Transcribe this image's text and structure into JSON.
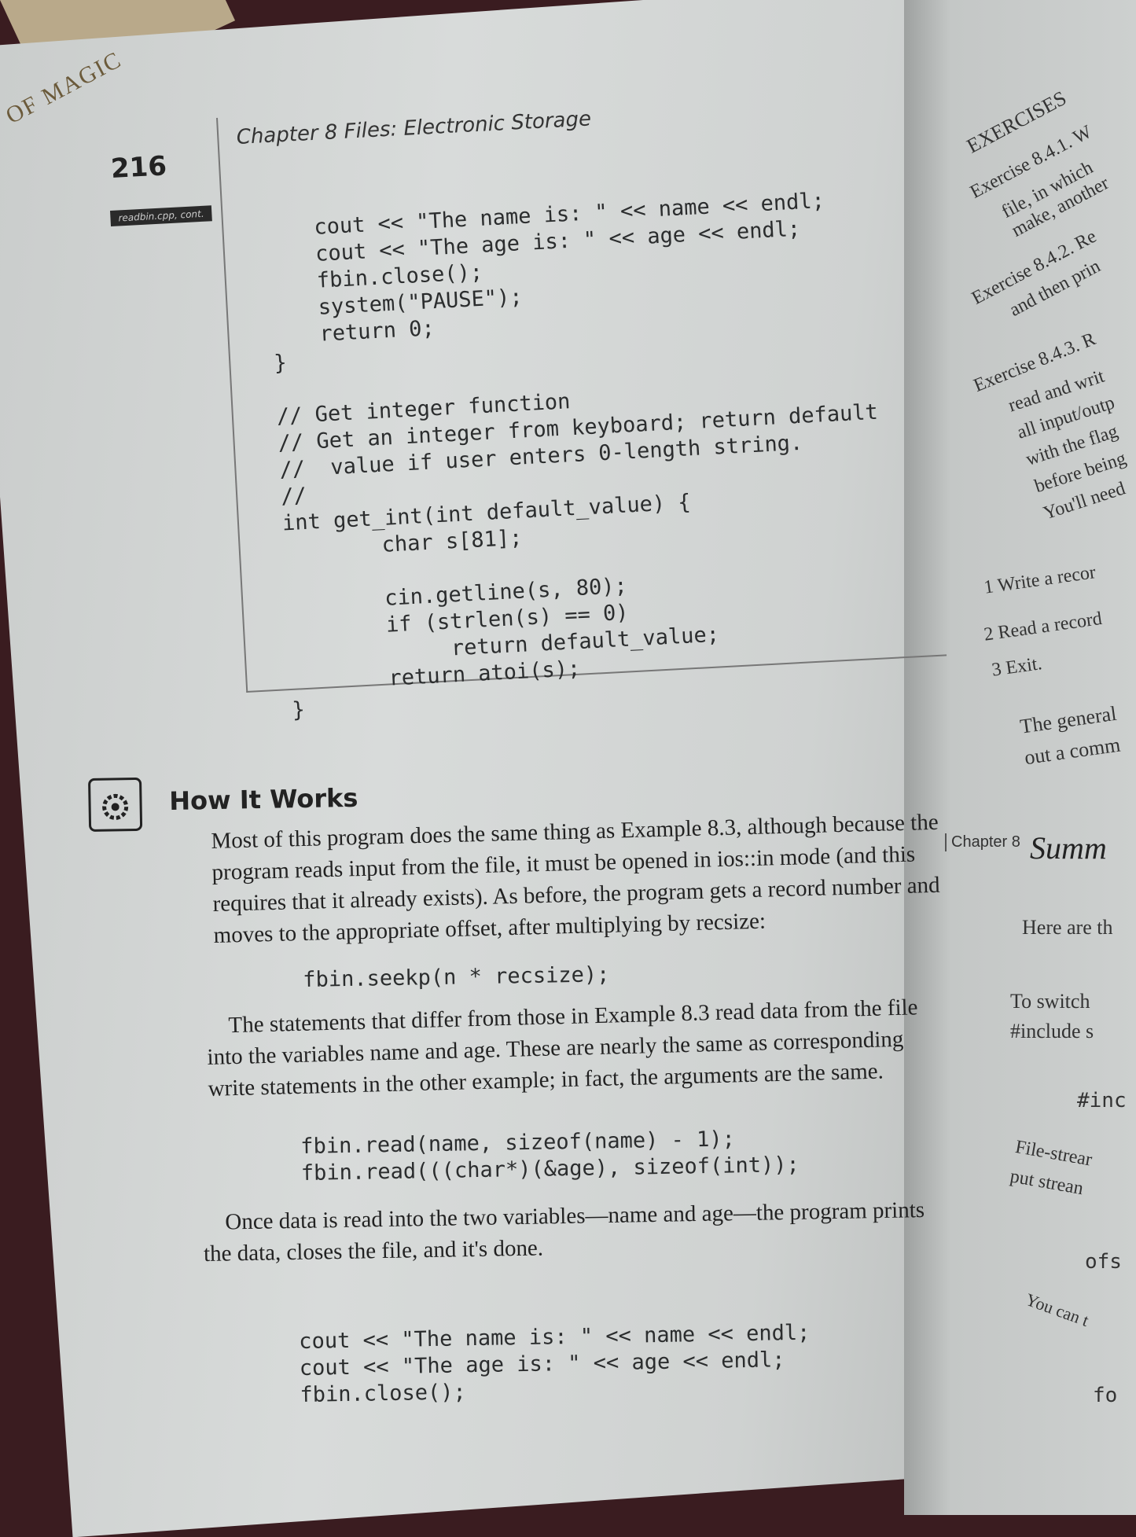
{
  "header": {
    "page_number": "216",
    "chapter": "Chapter 8   Files: Electronic Storage",
    "file_tag": "readbin.cpp, cont.",
    "edge_text": "OF MAGIC"
  },
  "code_listing": [
    "cout << \"The name is: \" << name << endl;",
    "cout << \"The age is: \" << age << endl;",
    "fbin.close();",
    "system(\"PAUSE\");",
    "return 0;",
    "}",
    "",
    "// Get integer function",
    "// Get an integer from keyboard; return default",
    "//  value if user enters 0-length string.",
    "//",
    "int get_int(int default_value) {",
    "    char s[81];",
    "",
    "    cin.getline(s, 80);",
    "    if (strlen(s) == 0)",
    "         return default_value;",
    "    return atoi(s);",
    "}"
  ],
  "how_it_works": {
    "icon_label": "How it Works",
    "title": "How It Works",
    "para1": "Most of this program does the same thing as Example 8.3, although because the program reads input from the file, it must be opened in ios::in mode (and this requires that it already exists). As before, the program gets a record number and moves to the appropriate offset, after multiplying by recsize:",
    "code1": "fbin.seekp(n * recsize);",
    "para2": "The statements that differ from those in Example 8.3 read data from the file into the variables name and age. These are nearly the same as corresponding write statements in the other example; in fact, the arguments are the same.",
    "code2": "fbin.read(name, sizeof(name) - 1);\nfbin.read(((char*)(&age), sizeof(int));",
    "para3": "Once data is read into the two variables—name and age—the program prints the data, closes the file, and it's done.",
    "code3": "cout << \"The name is: \" << name << endl;\ncout << \"The age is: \" << age << endl;\nfbin.close();"
  },
  "right_page": {
    "exercises_heading": "EXERCISES",
    "ex1": "Exercise 8.4.1.  W",
    "ex1_text": "file, in which \nmake, another",
    "ex2": "Exercise 8.4.2.  Re",
    "ex2_text": "and then prin",
    "ex3": "Exercise 8.4.3.  R",
    "ex3_text": "read and writ\nall input/outp\nwith the flag\nbefore being\nYou'll need",
    "menu": [
      "1  Write a recor",
      "2  Read a record",
      "3  Exit."
    ],
    "general": "The general\nout a comm",
    "chapter_label": "Chapter 8",
    "summary": "Summ",
    "here": "Here are th",
    "bullets": [
      "To switch\n#include s",
      "#inc",
      "File-strear\nput strean",
      "ofs",
      "You can t",
      "fo"
    ]
  }
}
